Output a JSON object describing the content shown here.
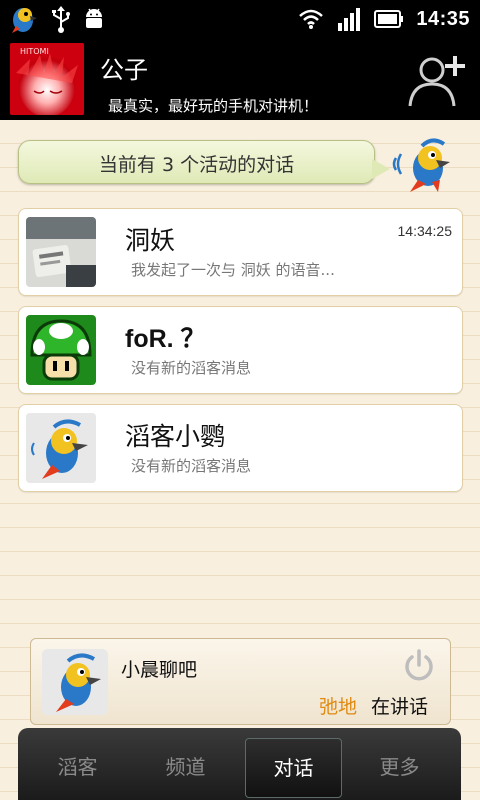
{
  "status_bar": {
    "time": "14:35",
    "icons": [
      "app-parrot-icon",
      "usb-icon",
      "android-debug-icon",
      "wifi-icon",
      "signal-icon",
      "battery-icon"
    ]
  },
  "header": {
    "name": "公子",
    "slogan": "最真实，最好玩的手机对讲机！",
    "avatar_text": "HITOMI"
  },
  "bubble": {
    "text": "当前有 3 个活动的对话"
  },
  "conversations": [
    {
      "title": "洞妖",
      "subtitle": "我发起了一次与 洞妖 的语音...",
      "time": "14:34:25"
    },
    {
      "title": "foR. ？",
      "subtitle": "没有新的滔客消息",
      "time": ""
    },
    {
      "title": "滔客小鹦",
      "subtitle": "没有新的滔客消息",
      "time": ""
    }
  ],
  "talk_panel": {
    "channel": "小晨聊吧",
    "speaker": "弛地",
    "status": "在讲话"
  },
  "tabs": [
    {
      "label": "滔客",
      "active": false
    },
    {
      "label": "频道",
      "active": false
    },
    {
      "label": "对话",
      "active": true
    },
    {
      "label": "更多",
      "active": false
    }
  ],
  "colors": {
    "speaker_accent": "#e08a10",
    "avatar_red": "#e0001a",
    "bubble_green": "#dfe9b6"
  }
}
